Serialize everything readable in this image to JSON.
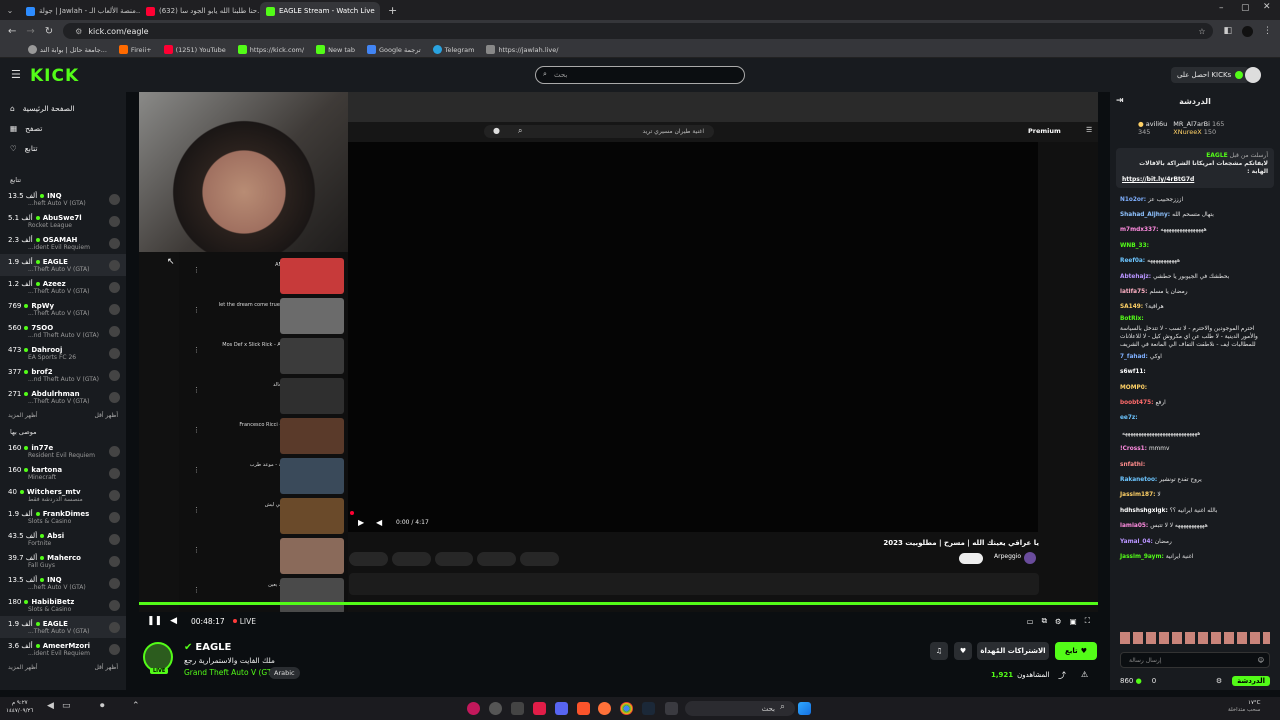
{
  "browser": {
    "tabs": [
      {
        "label": "جولة | Jawlah - منصة الألعاب الـ..."
      },
      {
        "label": "(632) حنا طلبنا الله يابو الجود سا..."
      },
      {
        "label": "EAGLE Stream - Watch Live"
      }
    ],
    "url": "kick.com/eagle",
    "bookmarks": [
      "جامعة حائل | بوابة الند...",
      "Fireii+",
      "(1251) YouTube",
      "https://kick.com/",
      "New tab",
      "Google ترجمة",
      "Telegram",
      "https://jawlah.live/"
    ]
  },
  "header": {
    "logo": "KICK",
    "search_placeholder": "بحث",
    "get_kicks": "احصل على KICKs"
  },
  "sidebar": {
    "nav": [
      {
        "label": "الصفحة الرئيسية",
        "icon": "home-icon"
      },
      {
        "label": "تصفح",
        "icon": "browse-icon"
      },
      {
        "label": "تتابع",
        "icon": "heart-icon"
      }
    ],
    "following_title": "تتابع",
    "following": [
      {
        "viewers": "13.5 ألف",
        "name": "INQ",
        "category": "...heft Auto V (GTA)"
      },
      {
        "viewers": "5.1 ألف",
        "name": "AbuSwe7l",
        "category": "Rocket League"
      },
      {
        "viewers": "2.3 ألف",
        "name": "OSAMAH",
        "category": "...ident Evil Requiem"
      },
      {
        "viewers": "1.9 ألف",
        "name": "EAGLE",
        "category": "...Theft Auto V (GTA)"
      },
      {
        "viewers": "1.2 ألف",
        "name": "Azeez",
        "category": "...Theft Auto V (GTA)"
      },
      {
        "viewers": "769",
        "name": "RpWy",
        "category": "...Theft Auto V (GTA)"
      },
      {
        "viewers": "560",
        "name": "7SOO",
        "category": "...nd Theft Auto V (GTA)"
      },
      {
        "viewers": "473",
        "name": "Dahrooj",
        "category": "EA Sports FC 26"
      },
      {
        "viewers": "377",
        "name": "brof2",
        "category": "...nd Theft Auto V (GTA)"
      },
      {
        "viewers": "271",
        "name": "Abdulrhman",
        "category": "...Theft Auto V (GTA)"
      }
    ],
    "show_more": "أظهر المزيد",
    "show_less": "أظهر أقل",
    "recommended_title": "موصى بها",
    "recommended": [
      {
        "viewers": "160",
        "name": "in77e",
        "category": "Resident Evil Requiem"
      },
      {
        "viewers": "160",
        "name": "kartona",
        "category": "Minecraft"
      },
      {
        "viewers": "40",
        "name": "Witchers_mtv",
        "category": "منصسة الدردشة فقط"
      },
      {
        "viewers": "1.9 ألف",
        "name": "FrankDimes",
        "category": "Slots & Casino"
      },
      {
        "viewers": "43.5 ألف",
        "name": "Absi",
        "category": "Fortnite"
      },
      {
        "viewers": "39.7 ألف",
        "name": "Maherco",
        "category": "Fall Guys"
      },
      {
        "viewers": "13.5 ألف",
        "name": "INQ",
        "category": "...heft Auto V (GTA)"
      },
      {
        "viewers": "180",
        "name": "HabibiBetz",
        "category": "Slots & Casino"
      },
      {
        "viewers": "1.9 ألف",
        "name": "EAGLE",
        "category": "...Theft Auto V (GTA)"
      },
      {
        "viewers": "3.6 ألف",
        "name": "AmeerMzori",
        "category": "...ident Evil Requiem"
      }
    ]
  },
  "video": {
    "yt_search": "اغنية طيران مسيري تريد",
    "yt_premium": "Premium",
    "yt_time": "0:00 / 4:17",
    "yt_title": "يا عراقي يعينك الله | مسرح | مطلوبيت 2023",
    "yt_channel": "Arpeggio",
    "yt_sidebar": [
      {
        "title": "AMERICANA"
      },
      {
        "title": "let the dream come true | dj bo bo hgolh"
      },
      {
        "title": "Mos Def x Slick Rick - Auditorium (Slowed)"
      },
      {
        "title": "يا عراقي - خالد"
      },
      {
        "title": "Francesco Ricci - Over You"
      },
      {
        "title": "اغاني عراقية - موعد طرب"
      },
      {
        "title": "انا شفت عيني ليش"
      },
      {
        "title": "ما عاد"
      },
      {
        "title": "يا عراقي ماد يعين"
      }
    ]
  },
  "player": {
    "time": "00:48:17",
    "live": "LIVE"
  },
  "stream": {
    "name": "EAGLE",
    "title": "ملك الفايت والاستمرارية رجع",
    "category": "Grand Theft Auto V (GTA)",
    "tag": "Arabic",
    "follow": "تابع",
    "subscribe": "الاشتراكات المُهداة",
    "viewers_label": "المشاهدون",
    "viewers": "1,921"
  },
  "chat": {
    "title": "الدردشة",
    "leaderboard": [
      {
        "name": "avili6u",
        "value": "345"
      },
      {
        "name": "MR_Al7arBi",
        "value": "165"
      },
      {
        "name": "XNureeX",
        "value": "150"
      }
    ],
    "pinned_user": "EAGLE",
    "pinned_by": "أرسلت من قبل",
    "pinned_text": "لايفاتكم مشجعات امريكانا الشراكة بالافالات الهابة :",
    "pinned_link": "https://bit.ly/4rBtG7d",
    "messages": [
      {
        "user": "N1o2or:",
        "text": "ازززجحبيب عز",
        "color": "#7fb0ff"
      },
      {
        "user": "Shahad_Aljhny:",
        "text": "بتهال متسحم الله",
        "color": "#8fc3ff"
      },
      {
        "user": "m7mdx337:",
        "text": "ههههههههههههههههه",
        "color": "#ff8ce0"
      },
      {
        "user": "WNB_33:",
        "text": "",
        "color": "#53fc18"
      },
      {
        "user": "Reef0a:",
        "text": "هههههههههههه",
        "color": "#6cc5ff"
      },
      {
        "user": "Abtehajz:",
        "text": "بحطشك في الجيوبور يا حطشي",
        "color": "#b894ff"
      },
      {
        "user": "latifa75:",
        "text": "رمضان يا مسلم",
        "color": "#ffb0c4"
      },
      {
        "user": "SA149:",
        "text": "هراقية؟",
        "color": "#ffd166"
      },
      {
        "user": "BotRix:",
        "text": "احترم الموجودين والاحترم - لا تسب - لا تتدخل بالسياسة والأمور الدينية - لا طلب عن اي مكروش كيل - لا للاعلانات للمطالبات ايف - نلاطفت التفاف الي المانعة في الشريف",
        "color": "#53fc18"
      },
      {
        "user": "7_fahad:",
        "text": "اوكي",
        "color": "#7fb0ff"
      },
      {
        "user": "s6wf11:",
        "text": "",
        "color": "#ffffff"
      },
      {
        "user": "MOMP0:",
        "text": "",
        "color": "#ffd166"
      },
      {
        "user": "boobt475:",
        "text": "ارفع",
        "color": "#ff6b6b"
      },
      {
        "user": "ee7z:",
        "text": "",
        "color": "#6cc5ff"
      },
      {
        "user": "",
        "text": "ههههههههههههههههههههههههههههه",
        "color": "#ffffff"
      },
      {
        "user": "!Cross1:",
        "text": "mmmv",
        "color": "#ff8ce0"
      },
      {
        "user": "snfathi:",
        "text": "",
        "color": "#ff8c8c"
      },
      {
        "user": "Rakanetoo:",
        "text": "يروح تفدع تونشير",
        "color": "#6cc5ff"
      },
      {
        "user": "Jassim187:",
        "text": "لا",
        "color": "#ffd166"
      },
      {
        "user": "hdhshshgxigk:",
        "text": "بالله اغنية ايرانيه ؟؟",
        "color": "#ffffff"
      },
      {
        "user": "lamia05:",
        "text": "هههههههههههه لا لا تتبس",
        "color": "#ff8ce0"
      },
      {
        "user": "Yamal_04:",
        "text": "رمضان",
        "color": "#b894ff"
      },
      {
        "user": "Jassim_9aym:",
        "text": "اغنية ايرانية",
        "color": "#53fc18"
      }
    ],
    "input_placeholder": "إرسال رسالة",
    "points": "860",
    "kicks": "0",
    "chat_button": "الدردشة"
  },
  "taskbar": {
    "search": "بحث",
    "time": "٩:٢٧ م",
    "date": "١٤٤٧/٠٩/٢٦",
    "weather_temp": "١٧°C",
    "weather_desc": "سحب متداخلة"
  }
}
